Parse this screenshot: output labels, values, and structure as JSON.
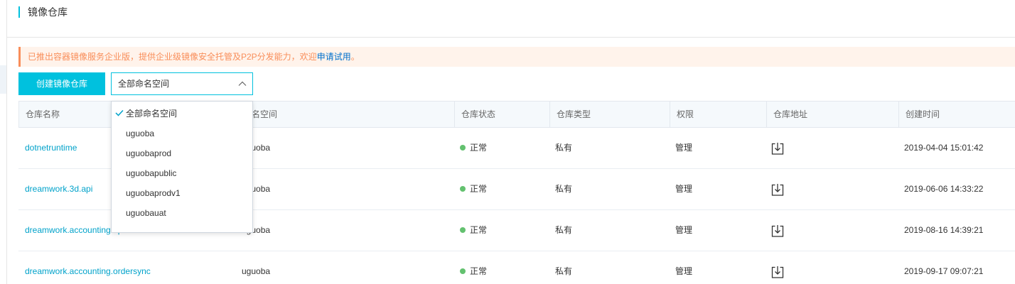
{
  "page": {
    "title": "镜像仓库"
  },
  "notice": {
    "text": "已推出容器镜像服务企业版，提供企业级镜像安全托管及P2P分发能力，欢迎",
    "link": "申请试用",
    "suffix": "。"
  },
  "toolbar": {
    "create_label": "创建镜像仓库",
    "namespace_selected": "全部命名空间"
  },
  "dropdown": {
    "options": [
      "全部命名空间",
      "uguoba",
      "uguobaprod",
      "uguobapublic",
      "uguobaprodv1",
      "uguobauat"
    ],
    "selected_index": 0
  },
  "table": {
    "columns": [
      "仓库名称",
      "命名空间",
      "仓库状态",
      "仓库类型",
      "权限",
      "仓库地址",
      "创建时间"
    ],
    "rows": [
      {
        "name": "dotnetruntime",
        "namespace": "uguoba",
        "status": "正常",
        "type": "私有",
        "permission": "管理",
        "created": "2019-04-04 15:01:42"
      },
      {
        "name": "dreamwork.3d.api",
        "namespace": "uguoba",
        "status": "正常",
        "type": "私有",
        "permission": "管理",
        "created": "2019-06-06 14:33:22"
      },
      {
        "name": "dreamwork.accounting.api",
        "namespace": "uguoba",
        "status": "正常",
        "type": "私有",
        "permission": "管理",
        "created": "2019-08-16 14:39:21"
      },
      {
        "name": "dreamwork.accounting.ordersync",
        "namespace": "uguoba",
        "status": "正常",
        "type": "私有",
        "permission": "管理",
        "created": "2019-09-17 09:07:21"
      }
    ]
  },
  "colors": {
    "accent": "#00c1de",
    "link": "#00a2ca",
    "status_ok": "#63c16f",
    "notice": "#f98e5a"
  },
  "icons": {
    "address": "download-icon",
    "select": "chevron-up-icon",
    "selected": "check-icon"
  }
}
